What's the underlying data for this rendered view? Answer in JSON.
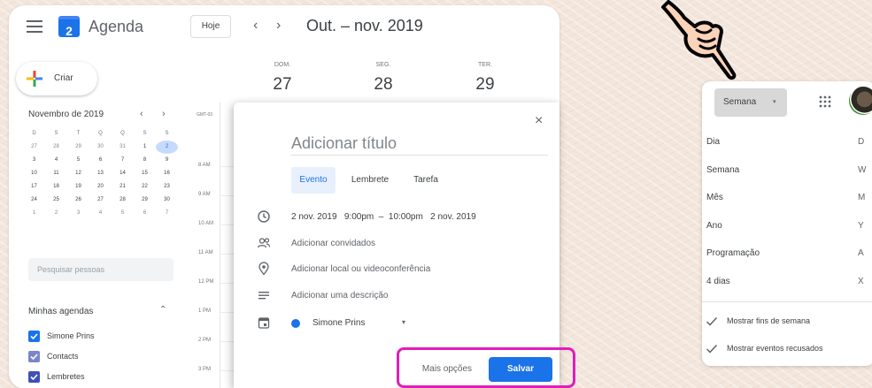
{
  "app": {
    "title": "Agenda",
    "logo_day": "2",
    "today_label": "Hoje",
    "prev_label": "‹",
    "next_label": "›",
    "date_range": "Out. – nov. 2019"
  },
  "sidebar": {
    "create_label": "Criar",
    "mini_calendar": {
      "title": "Novembro de 2019",
      "prev": "‹",
      "next": "›",
      "weekday_headers": [
        "D",
        "S",
        "T",
        "Q",
        "Q",
        "S",
        "S"
      ],
      "weeks": [
        [
          "27",
          "28",
          "29",
          "30",
          "31",
          "1",
          "2"
        ],
        [
          "3",
          "4",
          "5",
          "6",
          "7",
          "8",
          "9"
        ],
        [
          "10",
          "11",
          "12",
          "13",
          "14",
          "15",
          "16"
        ],
        [
          "17",
          "18",
          "19",
          "20",
          "21",
          "22",
          "23"
        ],
        [
          "24",
          "25",
          "26",
          "27",
          "28",
          "29",
          "30"
        ],
        [
          "1",
          "2",
          "3",
          "4",
          "5",
          "6",
          "7"
        ]
      ],
      "selected": "2"
    },
    "search_placeholder": "Pesquisar pessoas",
    "my_calendars_title": "Minhas agendas",
    "my_calendars_chevron": "⌃",
    "calendars": [
      {
        "name": "Simone Prins",
        "color": "#1a73e8"
      },
      {
        "name": "Contacts",
        "color": "#7986cb"
      },
      {
        "name": "Lembretes",
        "color": "#3f51b5"
      }
    ]
  },
  "week": {
    "timezone": "GMT-03",
    "days": [
      {
        "name": "DOM.",
        "date": "27"
      },
      {
        "name": "SEG.",
        "date": "28"
      },
      {
        "name": "TER.",
        "date": "29"
      }
    ],
    "hours": [
      "8 AM",
      "9 AM",
      "10 AM",
      "11 AM",
      "12 PM",
      "1 PM",
      "2 PM",
      "3 PM"
    ]
  },
  "dialog": {
    "close": "×",
    "title_placeholder": "Adicionar título",
    "tabs": [
      "Evento",
      "Lembrete",
      "Tarefa"
    ],
    "active_tab": "Evento",
    "datetime": "2 nov. 2019   9:00pm  –  10:00pm   2 nov. 2019",
    "guests": "Adicionar convidados",
    "location": "Adicionar local ou videoconferência",
    "description": "Adicionar uma descrição",
    "owner": "Simone Prins",
    "owner_caret": "▾",
    "owner_color": "#1a73e8",
    "more_options": "Mais opções",
    "save": "Salvar"
  },
  "view_menu": {
    "current": "Semana",
    "caret": "▾",
    "items": [
      {
        "label": "Dia",
        "key": "D"
      },
      {
        "label": "Semana",
        "key": "W"
      },
      {
        "label": "Mês",
        "key": "M"
      },
      {
        "label": "Ano",
        "key": "Y"
      },
      {
        "label": "Programação",
        "key": "A"
      },
      {
        "label": "4 dias",
        "key": "X"
      }
    ],
    "toggles": [
      "Mostrar fins de semana",
      "Mostrar eventos recusados"
    ]
  },
  "colors": {
    "accent": "#1a73e8",
    "highlight": "#e11dba",
    "background": "#f3e6dc"
  }
}
